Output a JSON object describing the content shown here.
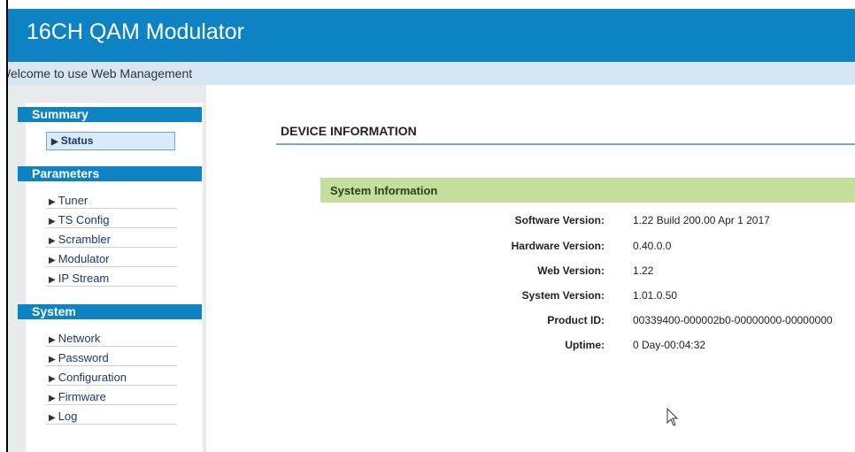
{
  "header": {
    "title": "16CH QAM Modulator"
  },
  "welcome": {
    "text": "Welcome to use Web Management"
  },
  "sidebar": {
    "sections": [
      {
        "title": "Summary",
        "items": [
          "Status"
        ]
      },
      {
        "title": "Parameters",
        "items": [
          "Tuner",
          "TS Config",
          "Scrambler",
          "Modulator",
          "IP Stream"
        ]
      },
      {
        "title": "System",
        "items": [
          "Network",
          "Password",
          "Configuration",
          "Firmware",
          "Log"
        ]
      }
    ],
    "active_item": "Status"
  },
  "main": {
    "page_title": "DEVICE INFORMATION",
    "panel_title": "System Information",
    "rows": [
      {
        "label": "Software Version:",
        "value": "1.22 Build 200.00 Apr 1 2017"
      },
      {
        "label": "Hardware Version:",
        "value": "0.40.0.0"
      },
      {
        "label": "Web Version:",
        "value": "1.22"
      },
      {
        "label": "System Version:",
        "value": "1.01.0.50"
      },
      {
        "label": "Product ID:",
        "value": "00339400-000002b0-00000000-00000000"
      },
      {
        "label": "Uptime:",
        "value": "0 Day-00:04:32"
      }
    ]
  },
  "colors": {
    "header_bg": "#0e83c4",
    "welcome_bg": "#d6e6f2",
    "section_header_bg": "#0e83c4",
    "panel_bar_bg": "#c4de9b",
    "active_item_bg": "#d9eaf8"
  },
  "icons": {
    "nav_bullet": "triangle-right-icon",
    "cursor": "mouse-pointer-icon"
  }
}
